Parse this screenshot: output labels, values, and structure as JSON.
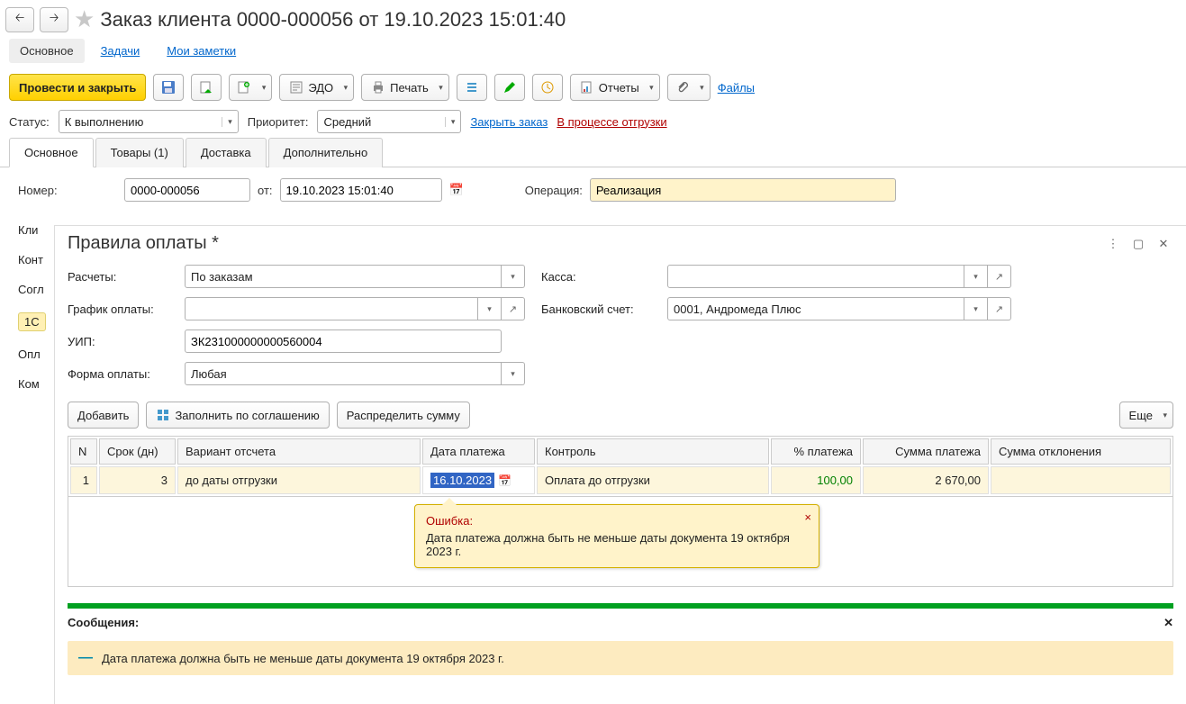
{
  "header": {
    "title": "Заказ клиента 0000-000056 от 19.10.2023 15:01:40"
  },
  "topTabs": {
    "main": "Основное",
    "tasks": "Задачи",
    "notes": "Мои заметки"
  },
  "toolbar": {
    "submit": "Провести и закрыть",
    "edo": "ЭДО",
    "print": "Печать",
    "reports": "Отчеты",
    "files": "Файлы"
  },
  "status": {
    "label": "Статус:",
    "value": "К выполнению",
    "priorityLabel": "Приоритет:",
    "priorityValue": "Средний",
    "closeOrder": "Закрыть заказ",
    "shipping": "В процессе отгрузки"
  },
  "docTabs": {
    "main": "Основное",
    "goods": "Товары (1)",
    "delivery": "Доставка",
    "extra": "Дополнительно"
  },
  "bgForm": {
    "numLabel": "Номер:",
    "numValue": "0000-000056",
    "fromLabel": "от:",
    "fromValue": "19.10.2023 15:01:40",
    "opLabel": "Операция:",
    "opValue": "Реализация"
  },
  "sideLabels": {
    "client": "Кли",
    "contr": "Конт",
    "sog": "Согл",
    "chip": "1С",
    "opl": "Опл",
    "kom": "Ком"
  },
  "modal": {
    "title": "Правила оплаты *",
    "calcLabel": "Расчеты:",
    "calcValue": "По заказам",
    "kassaLabel": "Касса:",
    "kassaValue": "",
    "schedLabel": "График оплаты:",
    "schedValue": "",
    "bankLabel": "Банковский счет:",
    "bankValue": "0001, Андромеда Плюс",
    "uipLabel": "УИП:",
    "uipValue": "ЗК231000000000560004",
    "formLabel": "Форма оплаты:",
    "formValue": "Любая",
    "addBtn": "Добавить",
    "fillBtn": "Заполнить по соглашению",
    "distBtn": "Распределить сумму",
    "moreBtn": "Еще",
    "cols": {
      "n": "N",
      "days": "Срок (дн)",
      "variant": "Вариант отсчета",
      "date": "Дата платежа",
      "control": "Контроль",
      "pct": "% платежа",
      "sum": "Сумма платежа",
      "dev": "Сумма отклонения"
    },
    "row": {
      "n": "1",
      "days": "3",
      "variant": "до даты отгрузки",
      "date": "16.10.2023",
      "control": "Оплата до отгрузки",
      "pct": "100,00",
      "sum": "2 670,00",
      "dev": ""
    },
    "tooltip": {
      "title": "Ошибка:",
      "text": "Дата платежа должна быть не меньше даты документа 19 октября 2023 г."
    },
    "messages": {
      "header": "Сообщения:",
      "text": "Дата платежа должна быть не меньше даты документа 19 октября 2023 г."
    }
  }
}
